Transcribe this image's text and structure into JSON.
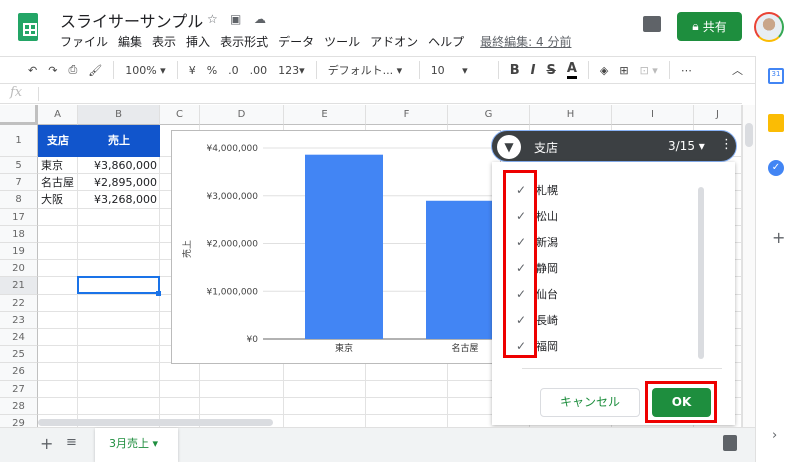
{
  "app": {
    "title": "スライサーサンプル",
    "menu": [
      "ファイル",
      "編集",
      "表示",
      "挿入",
      "表示形式",
      "データ",
      "ツール",
      "アドオン",
      "ヘルプ"
    ],
    "last_edit": "最終編集: 4 分前",
    "share_label": "共有",
    "accent": "#1e8e3e"
  },
  "toolbar": {
    "zoom": "100%",
    "currency": "¥",
    "percent": "%",
    "dec_less": ".0",
    "dec_more": ".00",
    "format": "123",
    "font": "デフォルト...",
    "size": "10",
    "bold": "B",
    "italic": "I",
    "strike": "S",
    "color": "A",
    "more": "⋯"
  },
  "formula": {
    "fx": "fx",
    "value": ""
  },
  "sheet": {
    "columns": [
      "A",
      "B",
      "C",
      "D",
      "E",
      "F",
      "G",
      "H",
      "I",
      "J"
    ],
    "rows": [
      "1",
      "5",
      "7",
      "8",
      "17",
      "18",
      "19",
      "20",
      "21",
      "22",
      "23",
      "24",
      "25",
      "26",
      "27",
      "28",
      "29"
    ],
    "header": {
      "a": "支店",
      "b": "売上"
    },
    "data": [
      {
        "a": "東京",
        "b": "¥3,860,000"
      },
      {
        "a": "名古屋",
        "b": "¥2,895,000"
      },
      {
        "a": "大阪",
        "b": "¥3,268,000"
      }
    ],
    "header_color": "#1155cc"
  },
  "chart_data": {
    "type": "bar",
    "categories": [
      "東京",
      "名古屋"
    ],
    "values": [
      3860000,
      2895000
    ],
    "ylabel": "売上",
    "ylim": [
      0,
      4000000
    ],
    "yticks": [
      "¥0",
      "¥1,000,000",
      "¥2,000,000",
      "¥3,000,000",
      "¥4,000,000"
    ],
    "color": "#4285f4",
    "grid": true
  },
  "slicer": {
    "column": "支店",
    "count": "3/15",
    "items": [
      "札幌",
      "松山",
      "新潟",
      "静岡",
      "仙台",
      "長崎",
      "福岡"
    ],
    "cancel": "キャンセル",
    "ok": "OK"
  },
  "tabs": {
    "sheet": "3月売上"
  }
}
